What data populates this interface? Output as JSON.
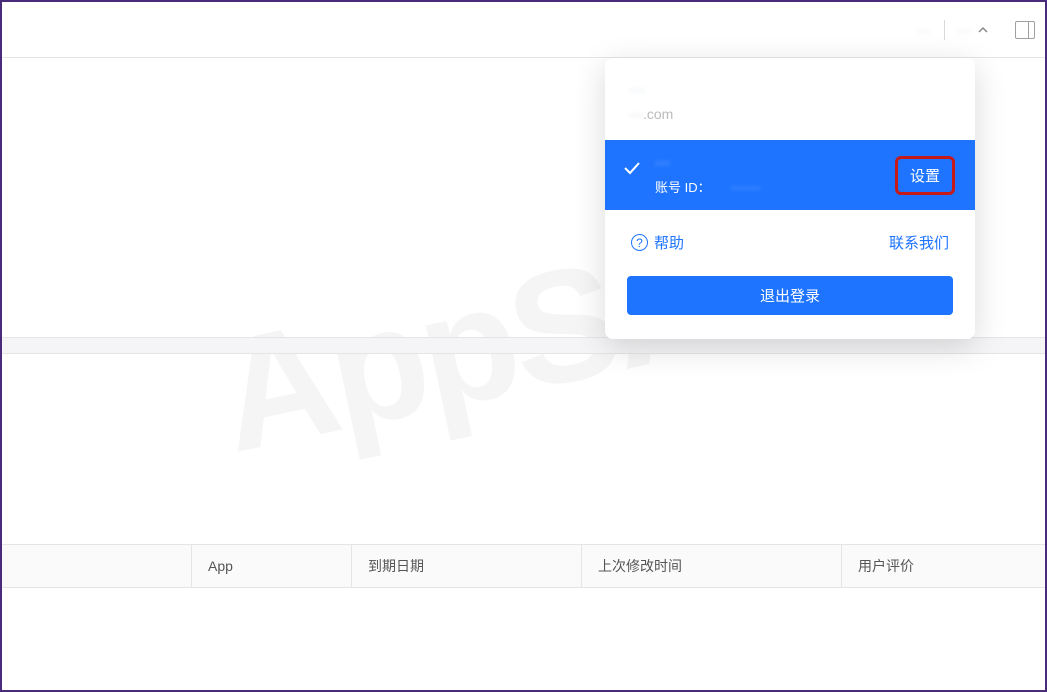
{
  "topbar": {
    "item_left": "···",
    "user_name": "···"
  },
  "dropdown": {
    "display_name": "···",
    "email_hidden": "···",
    "email_suffix": ".com",
    "account_name": "···",
    "account_id_label": "账号 ID：",
    "account_id_value": "·······",
    "settings_label": "设置",
    "help_label": "帮助",
    "contact_label": "联系我们",
    "logout_label": "退出登录"
  },
  "table": {
    "headers": [
      "",
      "App",
      "到期日期",
      "上次修改时间",
      "用户评价"
    ]
  },
  "watermark": "AppSA"
}
